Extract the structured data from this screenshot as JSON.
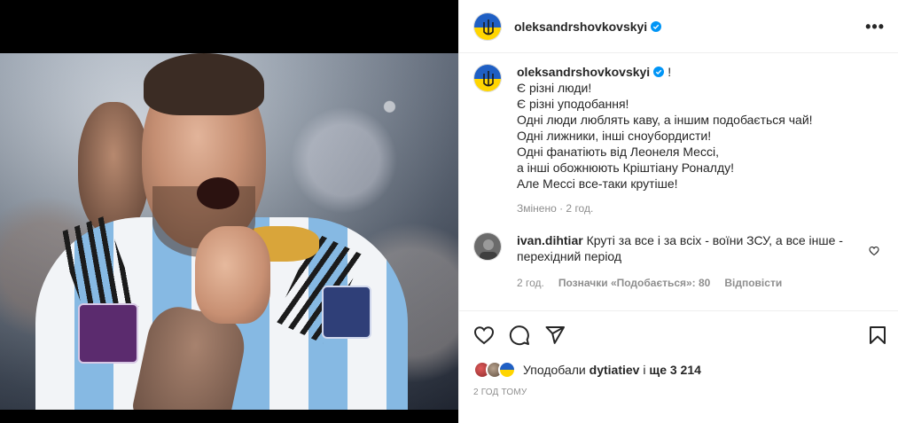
{
  "post": {
    "username": "oleksandrshovkovskyi",
    "header_username": "oleksandrshovkovskyi",
    "caption_suffix": "!",
    "caption_lines": [
      "Є різні люди!",
      "Є різні уподобання!",
      "Одні люди люблять каву, а іншим подобається чай!",
      "Одні лижники, інші сноубордисти!",
      "Одні фанатіють від Леонеля Мессі,",
      "а інші обожнюють Кріштіану Роналду!",
      "Але Мессі все-таки крутіше!"
    ],
    "caption_meta": "Змінено · 2 год.",
    "date": "2 ГОД ТОМУ"
  },
  "comment": {
    "username": "ivan.dihtiar",
    "text": "Круті за все і за всіх - воїни ЗСУ, а все інше - перехідний період",
    "time": "2 год.",
    "likes": "Позначки «Подобається»: 80",
    "reply": "Відповісти"
  },
  "likes": {
    "prefix": "Уподобали",
    "user": "dytiatiev",
    "connector": "і",
    "rest": "ще 3 214"
  },
  "icons": {
    "more": "more-options-icon",
    "verified": "verified-badge-icon",
    "heart": "heart-icon",
    "comment": "comment-icon",
    "share": "share-icon",
    "bookmark": "bookmark-icon"
  },
  "colors": {
    "verified": "#0095f6",
    "text": "#262626",
    "muted": "#8e8e8e",
    "flag_blue": "#1f5fc4",
    "flag_yellow": "#ffd500"
  }
}
